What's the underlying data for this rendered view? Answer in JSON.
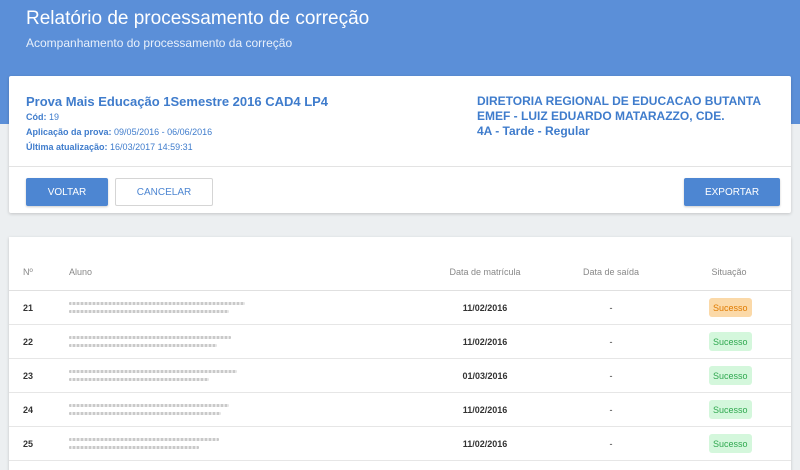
{
  "header": {
    "title": "Relatório de processamento de correção",
    "subtitle": "Acompanhamento do processamento da correção"
  },
  "exam": {
    "title": "Prova Mais Educação 1Semestre 2016 CAD4 LP4",
    "cod_label": "Cód:",
    "cod_value": "19",
    "aplicacao_label": "Aplicação da prova:",
    "aplicacao_value": "09/05/2016 - 06/06/2016",
    "atualizacao_label": "Última atualização:",
    "atualizacao_value": "16/03/2017 14:59:31"
  },
  "school": {
    "line1": "DIRETORIA REGIONAL DE EDUCACAO BUTANTA",
    "line2": "EMEF - LUIZ EDUARDO MATARAZZO, CDE.",
    "line3": "4A - Tarde - Regular"
  },
  "buttons": {
    "voltar": "VOLTAR",
    "cancelar": "CANCELAR",
    "exportar": "EXPORTAR"
  },
  "table": {
    "columns": [
      "Nº",
      "Aluno",
      "Data de matrícula",
      "Data de saída",
      "Situação"
    ],
    "rows": [
      {
        "num": "21",
        "matricula": "11/02/2016",
        "saida": "-",
        "situacao": "Sucesso",
        "tone": "warning"
      },
      {
        "num": "22",
        "matricula": "11/02/2016",
        "saida": "-",
        "situacao": "Sucesso",
        "tone": "success"
      },
      {
        "num": "23",
        "matricula": "01/03/2016",
        "saida": "-",
        "situacao": "Sucesso",
        "tone": "success"
      },
      {
        "num": "24",
        "matricula": "11/02/2016",
        "saida": "-",
        "situacao": "Sucesso",
        "tone": "success"
      },
      {
        "num": "25",
        "matricula": "11/02/2016",
        "saida": "-",
        "situacao": "Sucesso",
        "tone": "success"
      }
    ]
  },
  "colors": {
    "header_bg": "#5b8fd8",
    "accent": "#3f7ccc",
    "success_bg": "#d4f7dc",
    "success_fg": "#2fa84f",
    "warning_bg": "#fbd9a8",
    "warning_fg": "#e07b00"
  }
}
